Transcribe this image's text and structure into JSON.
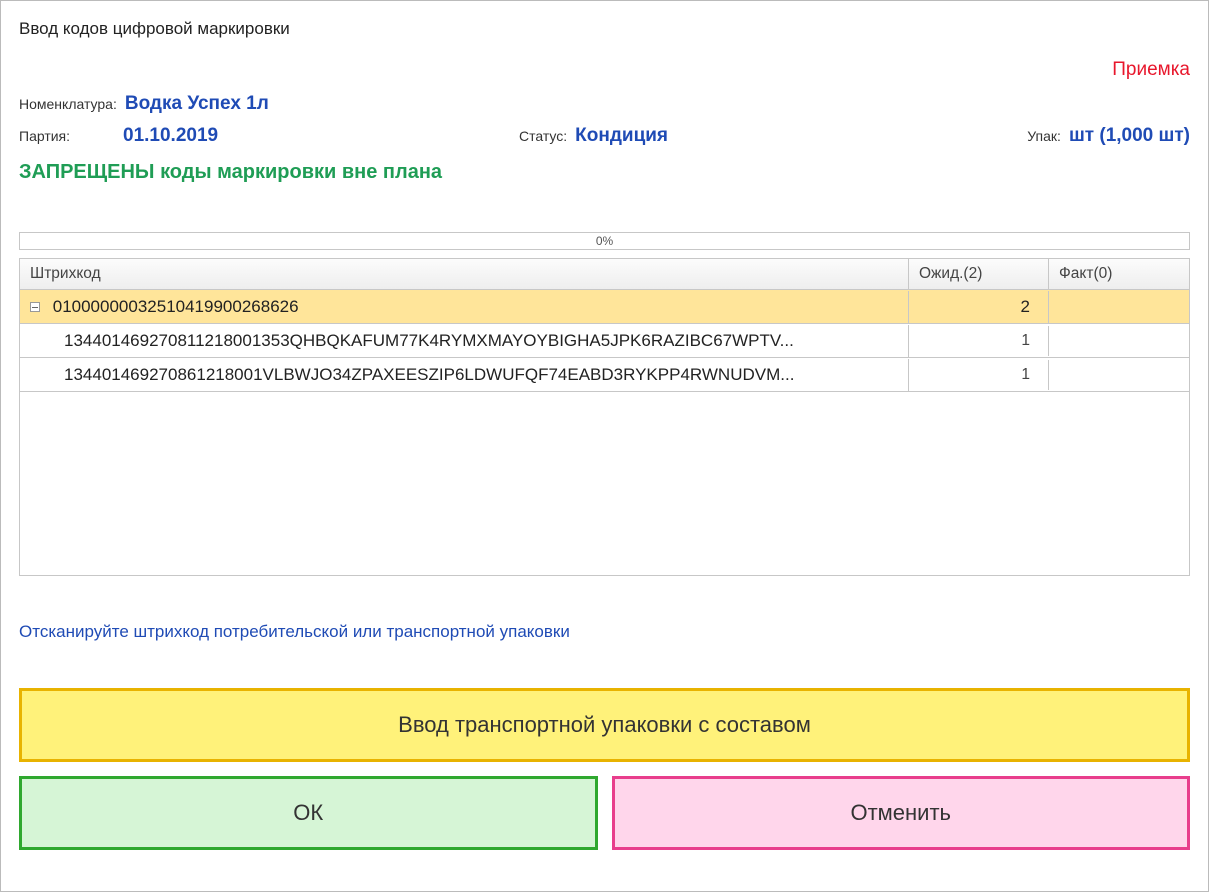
{
  "title": "Ввод кодов цифровой маркировки",
  "mode": "Приемка",
  "nomenclature": {
    "label": "Номенклатура:",
    "value": "Водка Успех 1л"
  },
  "party": {
    "label": "Партия:",
    "value": "01.10.2019"
  },
  "status": {
    "label": "Статус:",
    "value": "Кондиция"
  },
  "pack": {
    "label": "Упак:",
    "value": "шт (1,000 шт)"
  },
  "warning": "ЗАПРЕЩЕНЫ коды маркировки вне плана",
  "progress": "0%",
  "table": {
    "headers": {
      "barcode": "Штрихкод",
      "expected": "Ожид.(2)",
      "fact": "Факт(0)"
    },
    "group": {
      "barcode": "0100000003251041990026862​6",
      "expected": "2",
      "fact": ""
    },
    "rows": [
      {
        "barcode": "1344014692708112180013​53QHBQKAFUM77K4RYMXMAYOYBIGHA5JPK6RAZIBC67WPTV...",
        "expected": "1",
        "fact": ""
      },
      {
        "barcode": "1344014692708612180​01VLBWJO34ZPAXEESZIP6LDWUFQF74EABD3RYKPP4RWNUDVM...",
        "expected": "1",
        "fact": ""
      }
    ]
  },
  "prompt": "Отсканируйте штрихкод потребительской или транспортной упаковки",
  "buttons": {
    "transport": "Ввод транспортной упаковки с составом",
    "ok": "ОК",
    "cancel": "Отменить"
  }
}
